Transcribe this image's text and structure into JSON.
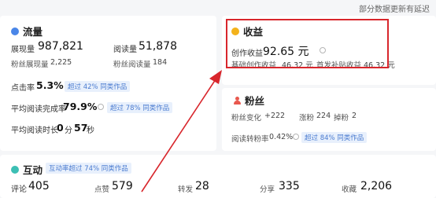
{
  "top_note": "部分数据更新有延迟",
  "traffic": {
    "title": "流量",
    "exposure_label": "展现量",
    "exposure_value": "987,821",
    "reads_label": "阅读量",
    "reads_value": "51,878",
    "fans_exposure_label": "粉丝展现量",
    "fans_exposure_value": "2,225",
    "fans_reads_label": "粉丝阅读量",
    "fans_reads_value": "184",
    "ctr_label": "点击率",
    "ctr_value": "5.3%",
    "ctr_badge": "超过 42% 同类作品",
    "completion_label": "平均阅读完成率",
    "completion_value": "79.9%",
    "completion_badge": "超过 78% 同类作品",
    "duration_label": "平均阅读时长",
    "duration_min": "0",
    "duration_min_unit": "分",
    "duration_sec": "57",
    "duration_sec_unit": "秒"
  },
  "income": {
    "title": "收益",
    "creation_label": "创作收益",
    "creation_value": "92.65 元",
    "base_label": "基础创作收益",
    "base_value": "46.32 元",
    "bonus_label": "首发补贴收益",
    "bonus_value": "46.32 元"
  },
  "fans": {
    "title": "粉丝",
    "change_label": "粉丝变化",
    "change_value": "+222",
    "gain_label": "涨粉",
    "gain_value": "224",
    "loss_label": "掉粉",
    "loss_value": "2",
    "conversion_label": "阅读转粉率",
    "conversion_value": "0.42%",
    "conversion_badge": "超过 84% 同类作品"
  },
  "interact": {
    "title": "互动",
    "badge": "互动率超过 74% 同类作品",
    "comments_label": "评论",
    "comments_value": "405",
    "likes_label": "点赞",
    "likes_value": "579",
    "shares_label": "转发",
    "shares_value": "28",
    "forward_label": "分享",
    "forward_value": "335",
    "favorites_label": "收藏",
    "favorites_value": "2,206"
  },
  "colors": {
    "highlight": "#d8262c",
    "badge_text": "#4a7bd0",
    "badge_bg": "#e8f0fc"
  }
}
